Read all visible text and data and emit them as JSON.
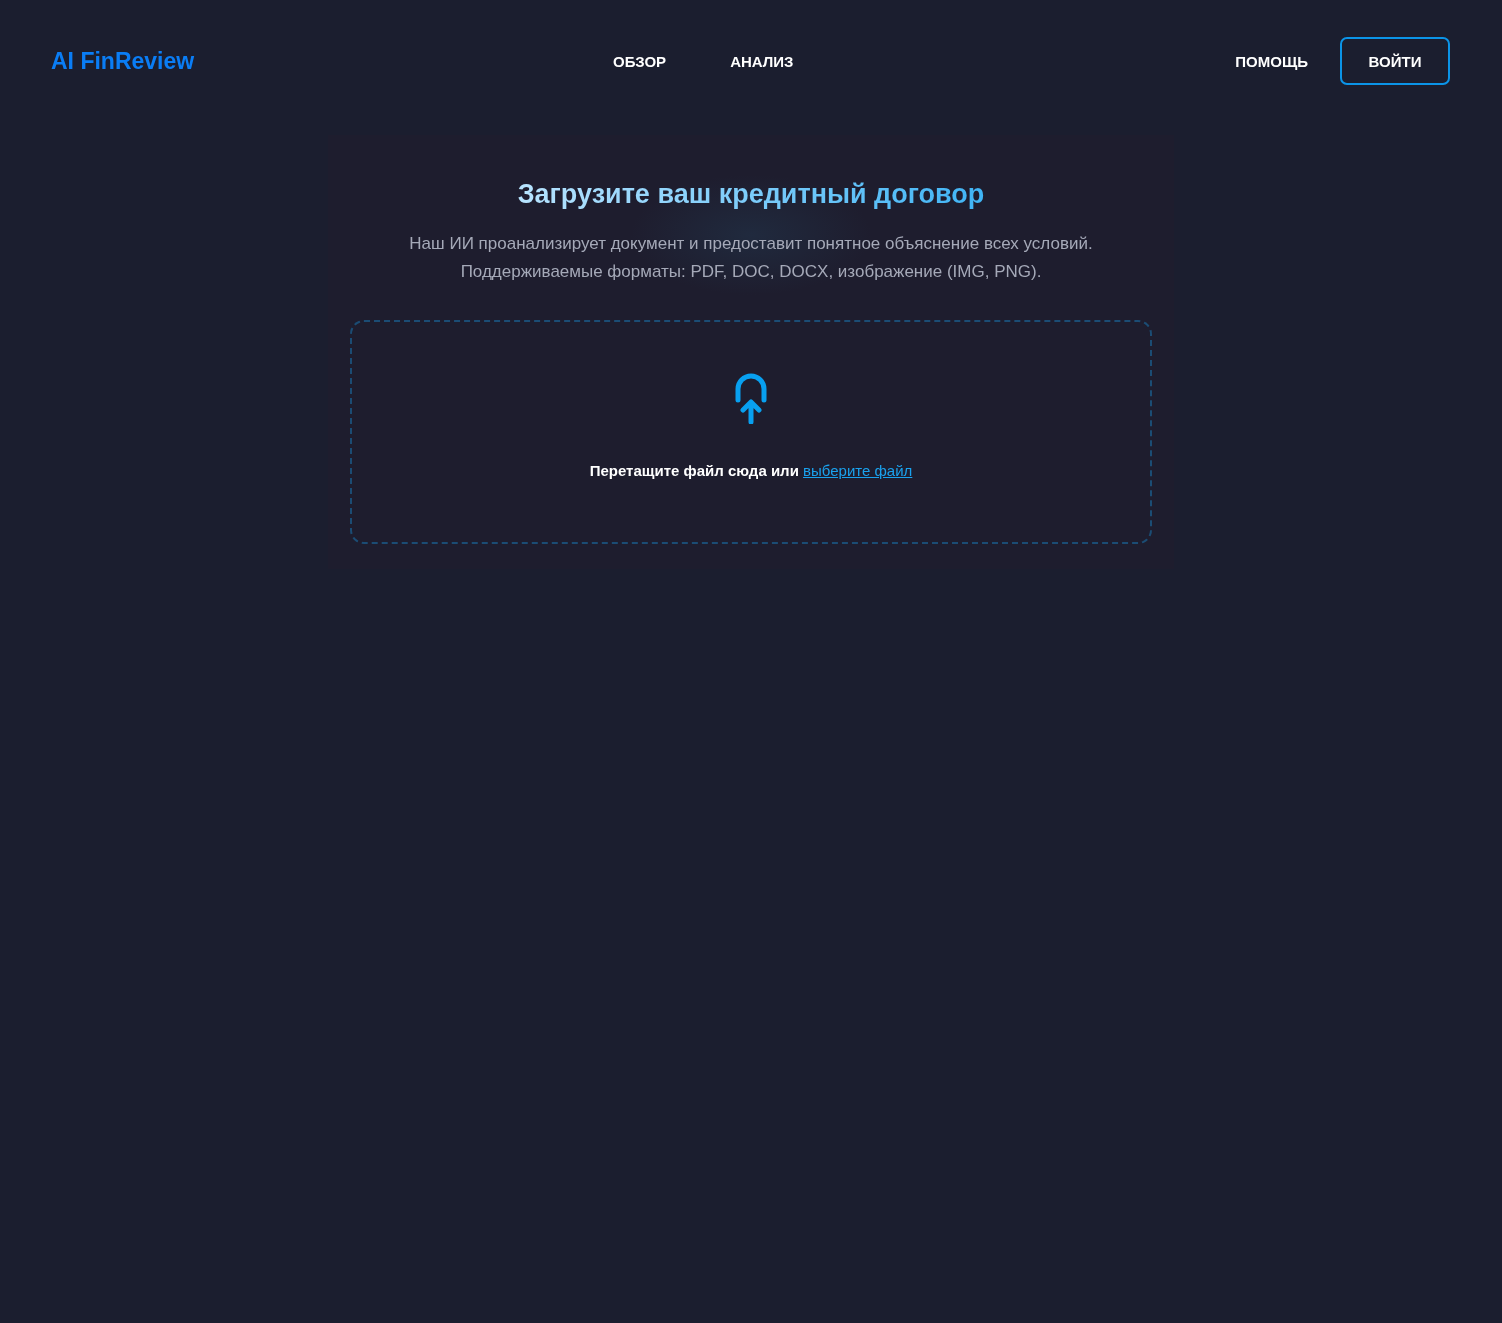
{
  "header": {
    "logo": "AI FinReview",
    "nav": [
      "ОБЗОР",
      "АНАЛИЗ"
    ],
    "help": "ПОМОЩЬ",
    "login": "ВОЙТИ"
  },
  "upload": {
    "title": "Загрузите ваш кредитный договор",
    "description": [
      "Наш ИИ проанализирует документ и предоставит понятное объяснение всех условий.",
      "Поддерживаемые форматы: PDF, DOC, DOCX, изображение (IMG, PNG)."
    ],
    "drop_text": "Перетащите файл сюда или",
    "choose_link": "выберите файл"
  }
}
